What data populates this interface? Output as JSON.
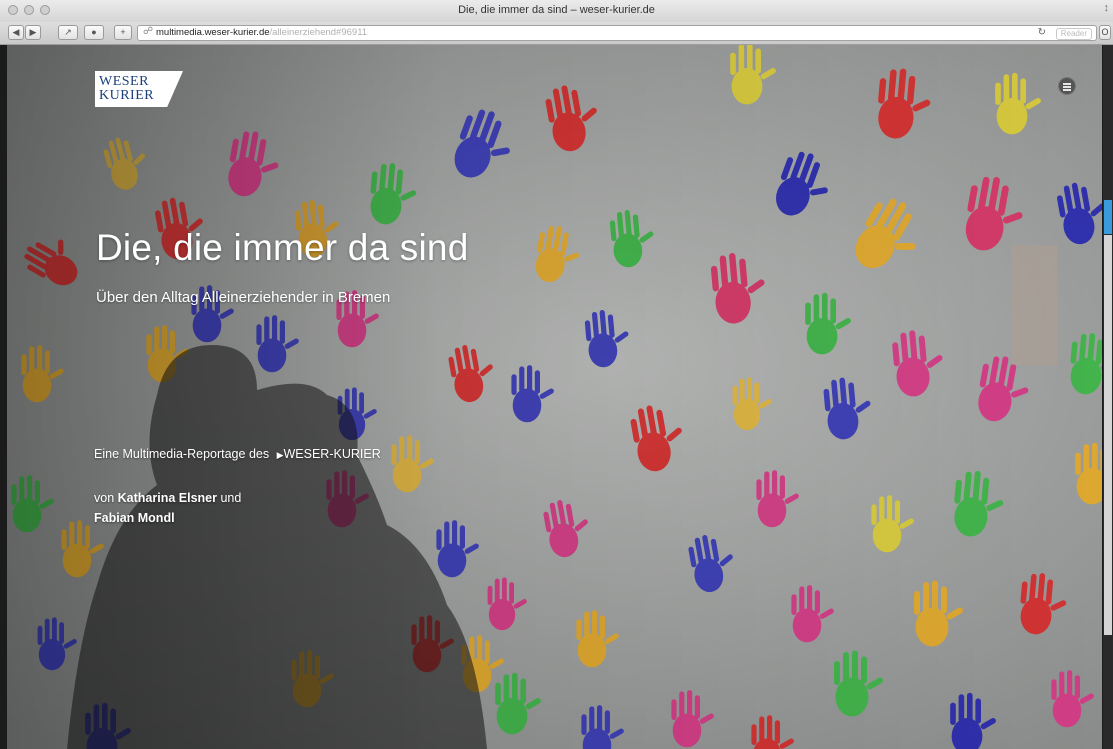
{
  "window": {
    "title": "Die, die immer da sind – weser-kurier.de"
  },
  "toolbar": {
    "url_host": "multimedia.weser-kurier.de",
    "url_path": "/alleinerziehend#96911",
    "reader_label": "Reader",
    "back_icon": "back-arrow",
    "forward_icon": "forward-arrow",
    "share_icon": "share",
    "add_icon": "plus",
    "reload_icon": "reload"
  },
  "header": {
    "logo_line1": "WESER",
    "logo_line2": "KURIER",
    "menu_icon": "hamburger-menu",
    "logo_color": "#1b3f7b"
  },
  "hero": {
    "title": "Die, die immer da sind",
    "subtitle": "Über den Alltag Alleinerziehender in Bremen",
    "reportage_prefix": "Eine Multimedia-Reportage des",
    "reportage_link": "WESER-KURIER",
    "authors_prefix": "von",
    "author1": "Katharina Elsner",
    "authors_and": "und",
    "author2": "Fabian Mondl"
  }
}
